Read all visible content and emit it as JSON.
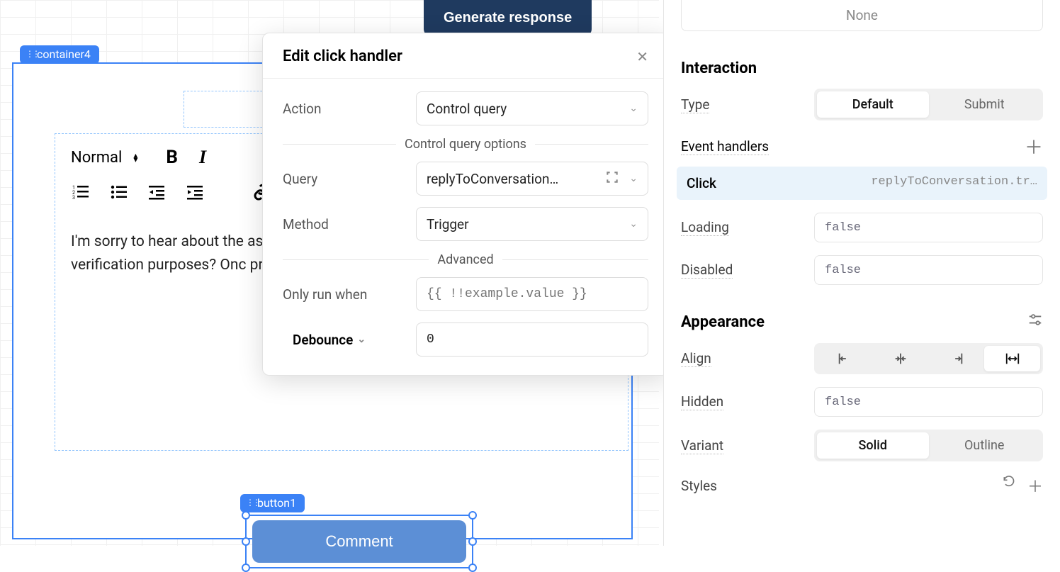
{
  "canvas": {
    "generate_button": "Generate response",
    "container_label": "container4",
    "button_label": "button1",
    "comment_button": "Comment",
    "editor": {
      "style_select": "Normal",
      "body_text": "I'm sorry to hear about the assured, we'll take care of name and the email addres verification purposes? Onc proceed with the refund pr your patience in this matte"
    }
  },
  "modal": {
    "title": "Edit click handler",
    "action_label": "Action",
    "action_value": "Control query",
    "options_divider": "Control query options",
    "query_label": "Query",
    "query_value": "replyToConversation…",
    "method_label": "Method",
    "method_value": "Trigger",
    "advanced_divider": "Advanced",
    "only_run_label": "Only run when",
    "only_run_placeholder": "{{ !!example.value }}",
    "debounce_label": "Debounce",
    "debounce_value": "0"
  },
  "inspector": {
    "none_label": "None",
    "interaction_title": "Interaction",
    "type_label": "Type",
    "type_default": "Default",
    "type_submit": "Submit",
    "event_handlers_label": "Event handlers",
    "event_click_name": "Click",
    "event_click_detail": "replyToConversation.tr…",
    "loading_label": "Loading",
    "loading_value": "false",
    "disabled_label": "Disabled",
    "disabled_value": "false",
    "appearance_title": "Appearance",
    "align_label": "Align",
    "hidden_label": "Hidden",
    "hidden_value": "false",
    "variant_label": "Variant",
    "variant_solid": "Solid",
    "variant_outline": "Outline",
    "styles_label": "Styles"
  }
}
